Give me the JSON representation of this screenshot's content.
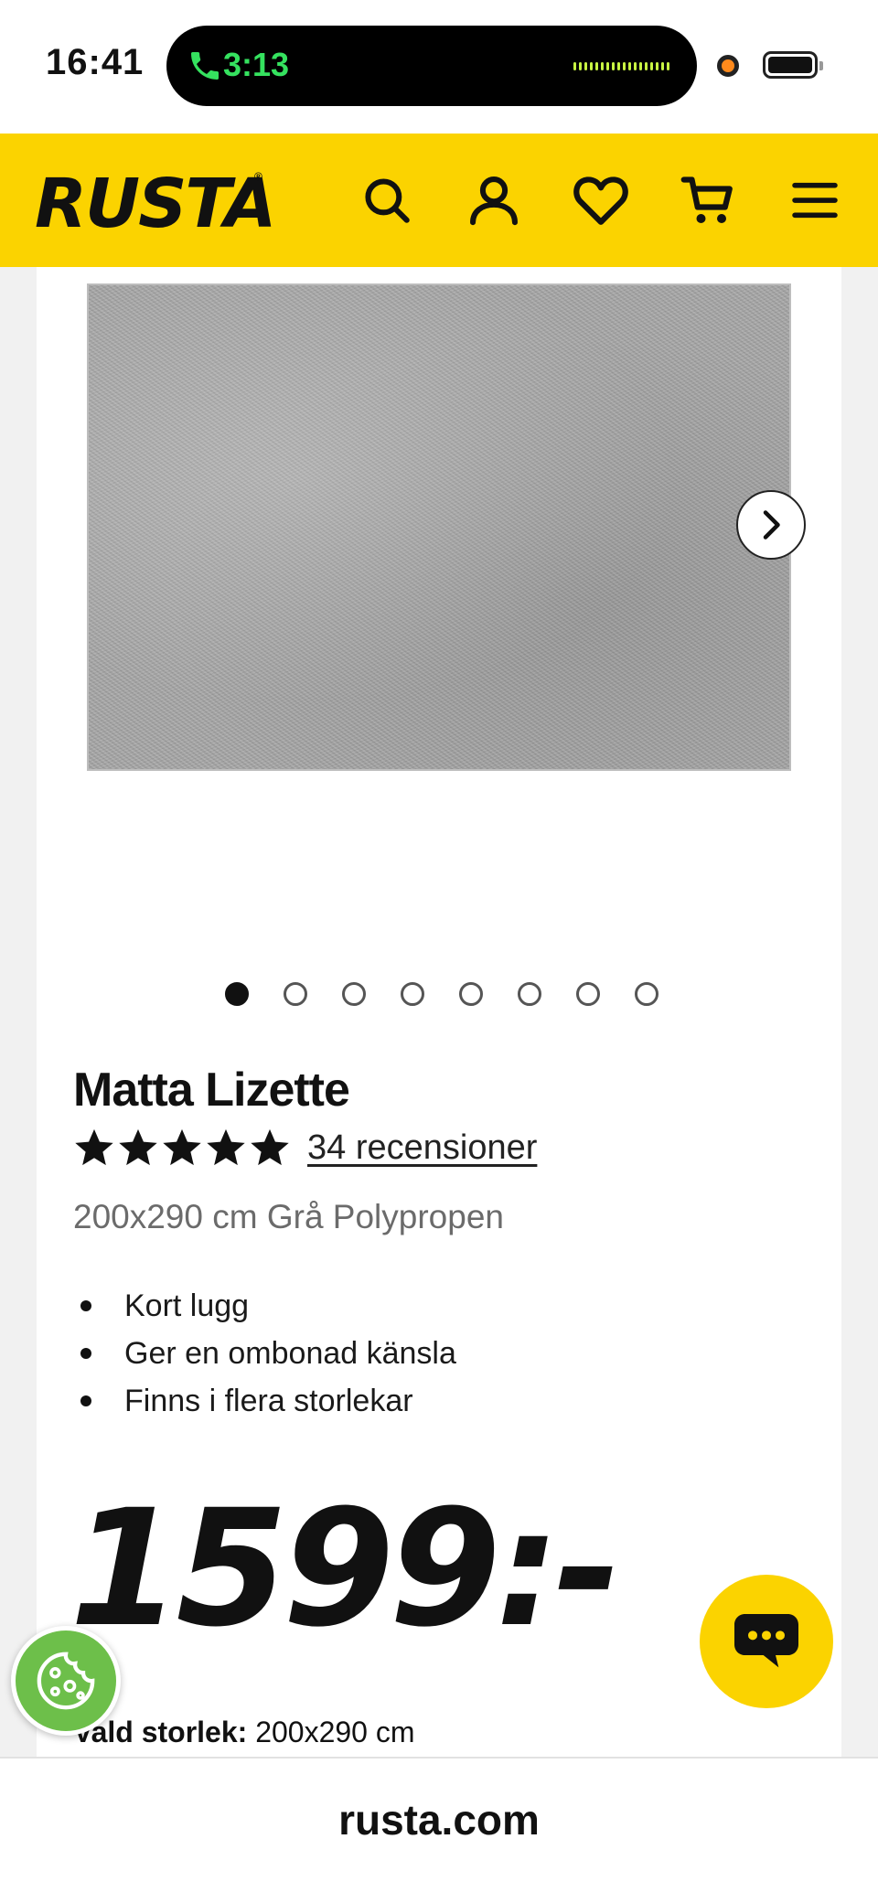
{
  "status_bar": {
    "time": "16:41",
    "call_time": "3:13"
  },
  "header": {
    "logo": "RUSTA",
    "icons": [
      "search-icon",
      "account-icon",
      "heart-icon",
      "cart-icon",
      "menu-icon"
    ],
    "background": "#fbd300"
  },
  "gallery": {
    "image_count": 8,
    "active_index": 0
  },
  "product": {
    "name": "Matta Lizette",
    "rating": 5,
    "reviews_label": "34 recensioner",
    "subtitle": "200x290 cm Grå Polypropen",
    "bullets": [
      "Kort lugg",
      "Ger en ombonad känsla",
      "Finns i flera storlekar"
    ],
    "price": "1599:-",
    "size_label": "Vald storlek:",
    "size_value": "200x290 cm"
  },
  "browser": {
    "url": "rusta.com"
  },
  "colors": {
    "brand_yellow": "#fbd300",
    "cookie_green": "#6dbf4a",
    "call_green": "#35e25f"
  }
}
